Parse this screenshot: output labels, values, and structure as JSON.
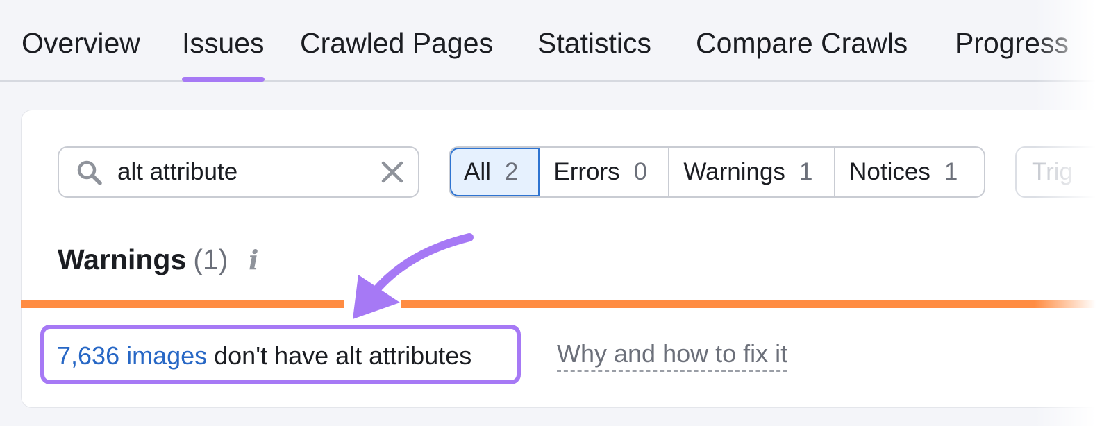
{
  "tabs": {
    "overview": "Overview",
    "issues": "Issues",
    "crawled_pages": "Crawled Pages",
    "statistics": "Statistics",
    "compare_crawls": "Compare Crawls",
    "progress": "Progress"
  },
  "search": {
    "value": "alt attribute"
  },
  "filters": {
    "all": {
      "label": "All",
      "count": "2"
    },
    "errors": {
      "label": "Errors",
      "count": "0"
    },
    "warnings": {
      "label": "Warnings",
      "count": "1"
    },
    "notices": {
      "label": "Notices",
      "count": "1"
    }
  },
  "trigger_placeholder": "Trig",
  "section": {
    "title": "Warnings",
    "count": "(1)",
    "info_glyph": "i"
  },
  "issue": {
    "link_text": "7,636 images",
    "rest_text": " don't have alt attributes",
    "fix_link": "Why and how to fix it"
  },
  "colors": {
    "accent_purple": "#a679f5",
    "warning_orange": "#ff8c42",
    "link_blue": "#2767c5",
    "selected_bg": "#e6f1fe"
  },
  "icons": [
    "search-icon",
    "clear-icon",
    "info-icon",
    "arrow-annotation"
  ]
}
